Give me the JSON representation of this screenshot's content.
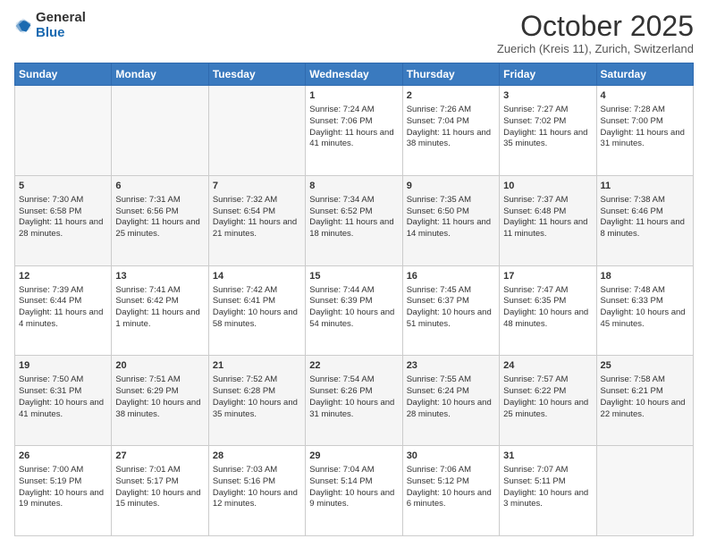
{
  "header": {
    "logo_general": "General",
    "logo_blue": "Blue",
    "month_title": "October 2025",
    "subtitle": "Zuerich (Kreis 11), Zurich, Switzerland"
  },
  "days_of_week": [
    "Sunday",
    "Monday",
    "Tuesday",
    "Wednesday",
    "Thursday",
    "Friday",
    "Saturday"
  ],
  "weeks": [
    [
      {
        "day": "",
        "info": ""
      },
      {
        "day": "",
        "info": ""
      },
      {
        "day": "",
        "info": ""
      },
      {
        "day": "1",
        "info": "Sunrise: 7:24 AM\nSunset: 7:06 PM\nDaylight: 11 hours and 41 minutes."
      },
      {
        "day": "2",
        "info": "Sunrise: 7:26 AM\nSunset: 7:04 PM\nDaylight: 11 hours and 38 minutes."
      },
      {
        "day": "3",
        "info": "Sunrise: 7:27 AM\nSunset: 7:02 PM\nDaylight: 11 hours and 35 minutes."
      },
      {
        "day": "4",
        "info": "Sunrise: 7:28 AM\nSunset: 7:00 PM\nDaylight: 11 hours and 31 minutes."
      }
    ],
    [
      {
        "day": "5",
        "info": "Sunrise: 7:30 AM\nSunset: 6:58 PM\nDaylight: 11 hours and 28 minutes."
      },
      {
        "day": "6",
        "info": "Sunrise: 7:31 AM\nSunset: 6:56 PM\nDaylight: 11 hours and 25 minutes."
      },
      {
        "day": "7",
        "info": "Sunrise: 7:32 AM\nSunset: 6:54 PM\nDaylight: 11 hours and 21 minutes."
      },
      {
        "day": "8",
        "info": "Sunrise: 7:34 AM\nSunset: 6:52 PM\nDaylight: 11 hours and 18 minutes."
      },
      {
        "day": "9",
        "info": "Sunrise: 7:35 AM\nSunset: 6:50 PM\nDaylight: 11 hours and 14 minutes."
      },
      {
        "day": "10",
        "info": "Sunrise: 7:37 AM\nSunset: 6:48 PM\nDaylight: 11 hours and 11 minutes."
      },
      {
        "day": "11",
        "info": "Sunrise: 7:38 AM\nSunset: 6:46 PM\nDaylight: 11 hours and 8 minutes."
      }
    ],
    [
      {
        "day": "12",
        "info": "Sunrise: 7:39 AM\nSunset: 6:44 PM\nDaylight: 11 hours and 4 minutes."
      },
      {
        "day": "13",
        "info": "Sunrise: 7:41 AM\nSunset: 6:42 PM\nDaylight: 11 hours and 1 minute."
      },
      {
        "day": "14",
        "info": "Sunrise: 7:42 AM\nSunset: 6:41 PM\nDaylight: 10 hours and 58 minutes."
      },
      {
        "day": "15",
        "info": "Sunrise: 7:44 AM\nSunset: 6:39 PM\nDaylight: 10 hours and 54 minutes."
      },
      {
        "day": "16",
        "info": "Sunrise: 7:45 AM\nSunset: 6:37 PM\nDaylight: 10 hours and 51 minutes."
      },
      {
        "day": "17",
        "info": "Sunrise: 7:47 AM\nSunset: 6:35 PM\nDaylight: 10 hours and 48 minutes."
      },
      {
        "day": "18",
        "info": "Sunrise: 7:48 AM\nSunset: 6:33 PM\nDaylight: 10 hours and 45 minutes."
      }
    ],
    [
      {
        "day": "19",
        "info": "Sunrise: 7:50 AM\nSunset: 6:31 PM\nDaylight: 10 hours and 41 minutes."
      },
      {
        "day": "20",
        "info": "Sunrise: 7:51 AM\nSunset: 6:29 PM\nDaylight: 10 hours and 38 minutes."
      },
      {
        "day": "21",
        "info": "Sunrise: 7:52 AM\nSunset: 6:28 PM\nDaylight: 10 hours and 35 minutes."
      },
      {
        "day": "22",
        "info": "Sunrise: 7:54 AM\nSunset: 6:26 PM\nDaylight: 10 hours and 31 minutes."
      },
      {
        "day": "23",
        "info": "Sunrise: 7:55 AM\nSunset: 6:24 PM\nDaylight: 10 hours and 28 minutes."
      },
      {
        "day": "24",
        "info": "Sunrise: 7:57 AM\nSunset: 6:22 PM\nDaylight: 10 hours and 25 minutes."
      },
      {
        "day": "25",
        "info": "Sunrise: 7:58 AM\nSunset: 6:21 PM\nDaylight: 10 hours and 22 minutes."
      }
    ],
    [
      {
        "day": "26",
        "info": "Sunrise: 7:00 AM\nSunset: 5:19 PM\nDaylight: 10 hours and 19 minutes."
      },
      {
        "day": "27",
        "info": "Sunrise: 7:01 AM\nSunset: 5:17 PM\nDaylight: 10 hours and 15 minutes."
      },
      {
        "day": "28",
        "info": "Sunrise: 7:03 AM\nSunset: 5:16 PM\nDaylight: 10 hours and 12 minutes."
      },
      {
        "day": "29",
        "info": "Sunrise: 7:04 AM\nSunset: 5:14 PM\nDaylight: 10 hours and 9 minutes."
      },
      {
        "day": "30",
        "info": "Sunrise: 7:06 AM\nSunset: 5:12 PM\nDaylight: 10 hours and 6 minutes."
      },
      {
        "day": "31",
        "info": "Sunrise: 7:07 AM\nSunset: 5:11 PM\nDaylight: 10 hours and 3 minutes."
      },
      {
        "day": "",
        "info": ""
      }
    ]
  ]
}
